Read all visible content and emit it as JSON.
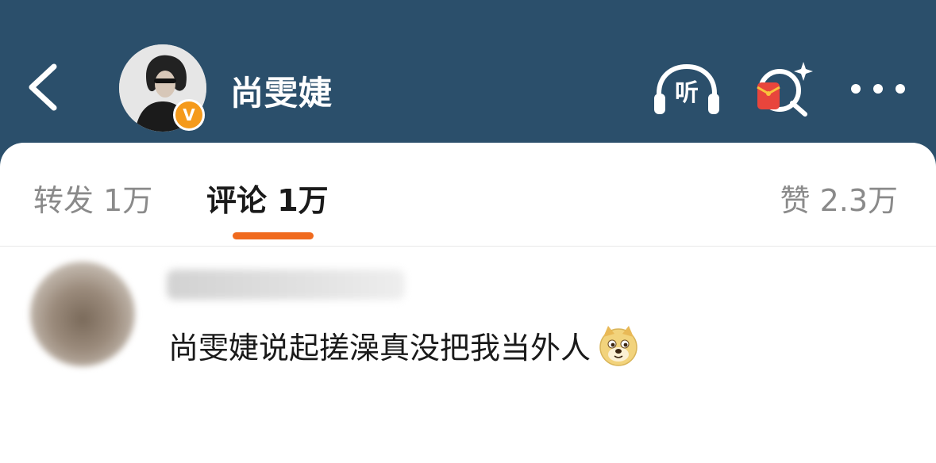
{
  "header": {
    "username": "尚雯婕",
    "badge": "V",
    "listen_label": "听",
    "colors": {
      "bar": "#2b4f6b",
      "badge": "#f59a1b",
      "accent": "#f06a1e"
    },
    "icons": {
      "back": "chevron-left-icon",
      "listen": "headphones-icon",
      "redpacket": "red-packet-search-icon",
      "more": "more-dots-icon"
    }
  },
  "tabs": {
    "repost": "转发 1万",
    "comment": "评论 1万",
    "like": "赞 2.3万"
  },
  "comment": {
    "text": "尚雯婕说起搓澡真没把我当外人",
    "emoji": "doge-emoji"
  }
}
